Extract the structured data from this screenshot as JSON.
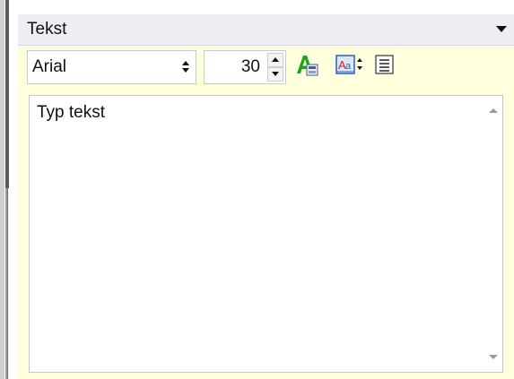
{
  "panel": {
    "title": "Tekst"
  },
  "toolbar": {
    "font_family_value": "Arial",
    "font_size_value": "30"
  },
  "text_area": {
    "value": "Typ tekst"
  },
  "colors": {
    "header_bg": "#eeeef4",
    "toolbar_bg": "#ffffdd",
    "font_color_icon": "#1aa61a",
    "highlight_icon_red": "#d02020",
    "highlight_icon_blue": "#2a5fc0"
  },
  "icons": [
    "chevron-down-icon",
    "font-color-icon",
    "text-style-icon",
    "align-icon",
    "scroll-up-icon",
    "scroll-down-icon"
  ]
}
